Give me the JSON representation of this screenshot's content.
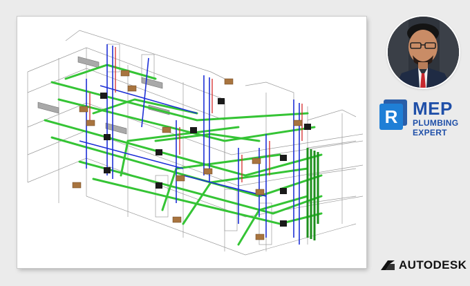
{
  "badge": {
    "icon_letter": "R",
    "title": "MEP",
    "subtitle_line1": "PLUMBING",
    "subtitle_line2": "EXPERT"
  },
  "brand": {
    "name": "AUTODESK"
  },
  "colors": {
    "background": "#ebebeb",
    "pipe_green": "#35c435",
    "pipe_blue": "#1d2fd6",
    "pipe_red": "#d62a2a",
    "fixture_brown": "#a8743f",
    "revit_blue": "#1f7fd6",
    "badge_text_blue": "#1f4fa8"
  },
  "icons": {
    "model": "plumbing-model-3d",
    "avatar": "profile-photo",
    "revit": "revit-logo-icon",
    "autodesk": "autodesk-logo-icon"
  }
}
